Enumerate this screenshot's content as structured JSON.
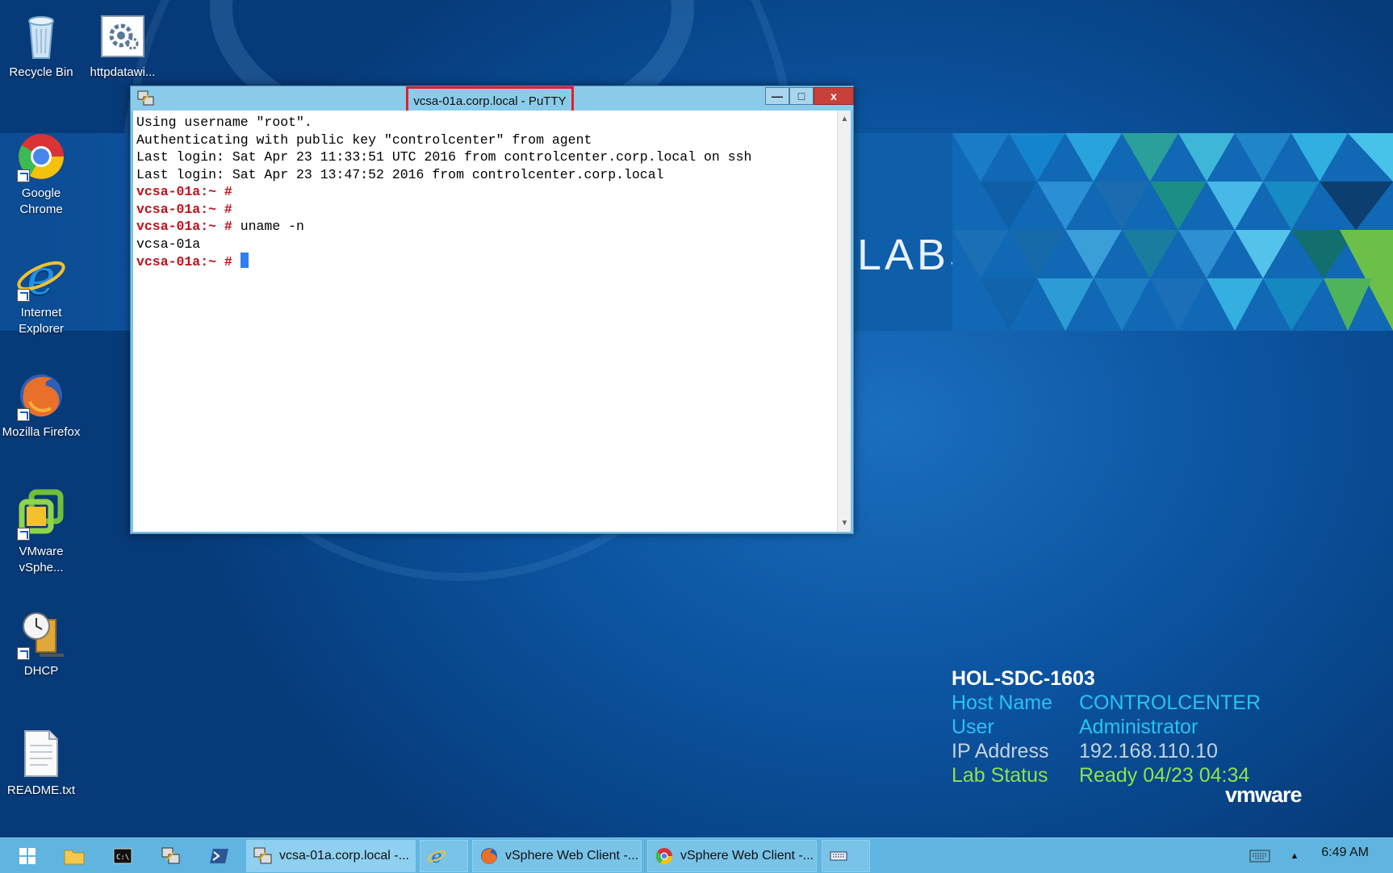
{
  "desktop": {
    "banner_text": "LABS",
    "icons": [
      {
        "label": "Recycle Bin",
        "icon": "recycle-bin-icon"
      },
      {
        "label": "httpdatawi...",
        "icon": "settings-file-icon"
      },
      {
        "label": "Google Chrome",
        "icon": "chrome-icon"
      },
      {
        "label": "Internet Explorer",
        "icon": "internet-explorer-icon"
      },
      {
        "label": "Mozilla Firefox",
        "icon": "firefox-icon"
      },
      {
        "label": "VMware vSphe...",
        "icon": "vmware-vsphere-icon"
      },
      {
        "label": "DHCP",
        "icon": "dhcp-icon"
      },
      {
        "label": "README.txt",
        "icon": "text-file-icon"
      }
    ]
  },
  "putty": {
    "title": "vcsa-01a.corp.local - PuTTY",
    "buttons": {
      "minimize": "—",
      "maximize": "□",
      "close": "x"
    },
    "terminal": {
      "lines": [
        {
          "prompt": "",
          "text": "Using username \"root\"."
        },
        {
          "prompt": "",
          "text": "Authenticating with public key \"controlcenter\" from agent"
        },
        {
          "prompt": "",
          "text": "Last login: Sat Apr 23 11:33:51 UTC 2016 from controlcenter.corp.local on ssh"
        },
        {
          "prompt": "",
          "text": "Last login: Sat Apr 23 13:47:52 2016 from controlcenter.corp.local"
        },
        {
          "prompt": "vcsa-01a:~ #",
          "text": ""
        },
        {
          "prompt": "vcsa-01a:~ #",
          "text": ""
        },
        {
          "prompt": "vcsa-01a:~ #",
          "text": " uname -n"
        },
        {
          "prompt": "",
          "text": "vcsa-01a"
        },
        {
          "prompt": "vcsa-01a:~ #",
          "text": " ",
          "cursor": true
        }
      ]
    }
  },
  "lab_info": {
    "lab_id": "HOL-SDC-1603",
    "rows": [
      {
        "label": "Host Name",
        "value": "CONTROLCENTER",
        "color": "#27c4f3"
      },
      {
        "label": "User",
        "value": "Administrator",
        "color": "#27c4f3"
      },
      {
        "label": "IP Address",
        "value": "192.168.110.10",
        "color": "#c3d2e0"
      },
      {
        "label": "Lab Status",
        "value": "Ready 04/23 04:34",
        "color": "#8fe24a"
      }
    ],
    "brand": "vmware"
  },
  "taskbar": {
    "start": "windows-start-icon",
    "quick_launch": [
      "file-explorer-icon",
      "command-prompt-icon",
      "putty-icon",
      "powershell-icon"
    ],
    "windows": [
      {
        "label": "vcsa-01a.corp.local -...",
        "icon": "putty-icon",
        "active": true
      },
      {
        "label": "",
        "icon": "internet-explorer-icon"
      },
      {
        "label": "vSphere Web Client -...",
        "icon": "firefox-icon"
      },
      {
        "label": "vSphere Web Client -...",
        "icon": "chrome-icon"
      },
      {
        "label": "",
        "icon": "keyboard-icon"
      }
    ],
    "tray": {
      "time": "6:49 AM"
    }
  }
}
